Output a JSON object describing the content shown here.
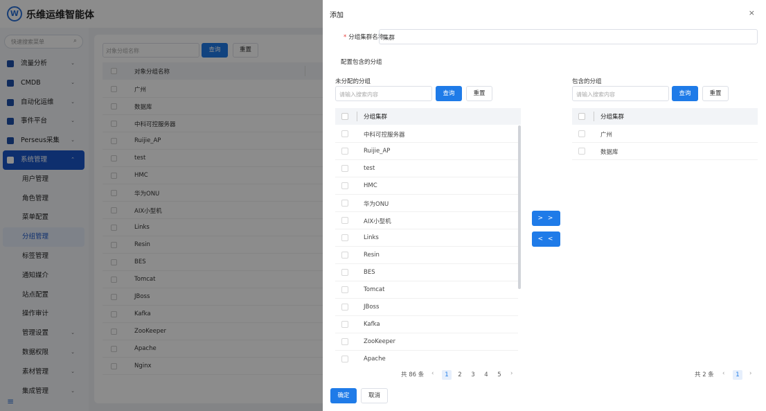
{
  "app": {
    "logo": "W",
    "title": "乐维运维智能体"
  },
  "sidebar": {
    "search_placeholder": "快速搜索菜单",
    "search_icon": "search-icon",
    "menu": [
      {
        "label": "流量分析",
        "icon": "chart-icon"
      },
      {
        "label": "CMDB",
        "icon": "cube-icon"
      },
      {
        "label": "自动化运维",
        "icon": "gear-icon"
      },
      {
        "label": "事件平台",
        "icon": "bell-icon"
      },
      {
        "label": "Perseus采集",
        "icon": "diamond-icon"
      },
      {
        "label": "系统管理",
        "icon": "settings-icon"
      }
    ],
    "submenu": [
      "用户管理",
      "角色管理",
      "菜单配置",
      "分组管理",
      "标签管理",
      "通知媒介",
      "站点配置",
      "操作审计"
    ],
    "menu_bottom": [
      "管理设置",
      "数据权限",
      "素材管理",
      "集成管理"
    ],
    "chevron_down": "⌄",
    "chevron_up": "⌃",
    "collapse_icon": "≡"
  },
  "background": {
    "search_placeholder": "对象分组名称",
    "query_label": "查询",
    "reset_label": "重置",
    "column": "对象分组名称",
    "rows": [
      "广州",
      "数据库",
      "中科可控服务器",
      "Ruijie_AP",
      "test",
      "HMC",
      "华为ONU",
      "AIX小型机",
      "Links",
      "Resin",
      "BES",
      "Tomcat",
      "JBoss",
      "Kafka",
      "ZooKeeper",
      "Apache",
      "Nginx"
    ]
  },
  "drawer": {
    "title": "添加",
    "close": "×",
    "name_label": "分组集群名称",
    "required_mark": "*",
    "name_value": "集群",
    "config_label": "配置包含的分组",
    "left": {
      "title": "未分配的分组",
      "placeholder": "请输入搜索内容",
      "query": "查询",
      "reset": "重置",
      "column": "分组集群",
      "items": [
        "中科可控服务器",
        "Ruijie_AP",
        "test",
        "HMC",
        "华为ONU",
        "AIX小型机",
        "Links",
        "Resin",
        "BES",
        "Tomcat",
        "JBoss",
        "Kafka",
        "ZooKeeper",
        "Apache"
      ],
      "total": "共 86 条",
      "pages": [
        "1",
        "2",
        "3",
        "4",
        "5"
      ],
      "current_page": "1",
      "prev": "‹",
      "next": "›"
    },
    "right": {
      "title": "包含的分组",
      "placeholder": "请输入搜索内容",
      "query": "查询",
      "reset": "重置",
      "column": "分组集群",
      "items": [
        "广州",
        "数据库"
      ],
      "total": "共 2 条",
      "pages": [
        "1"
      ],
      "prev": "‹",
      "next": "›"
    },
    "move_right": "> >",
    "move_left": "< <",
    "confirm": "确定",
    "cancel": "取消"
  },
  "colors": {
    "primary": "#1f7be8",
    "sidebar_active": "#1a57c8"
  }
}
